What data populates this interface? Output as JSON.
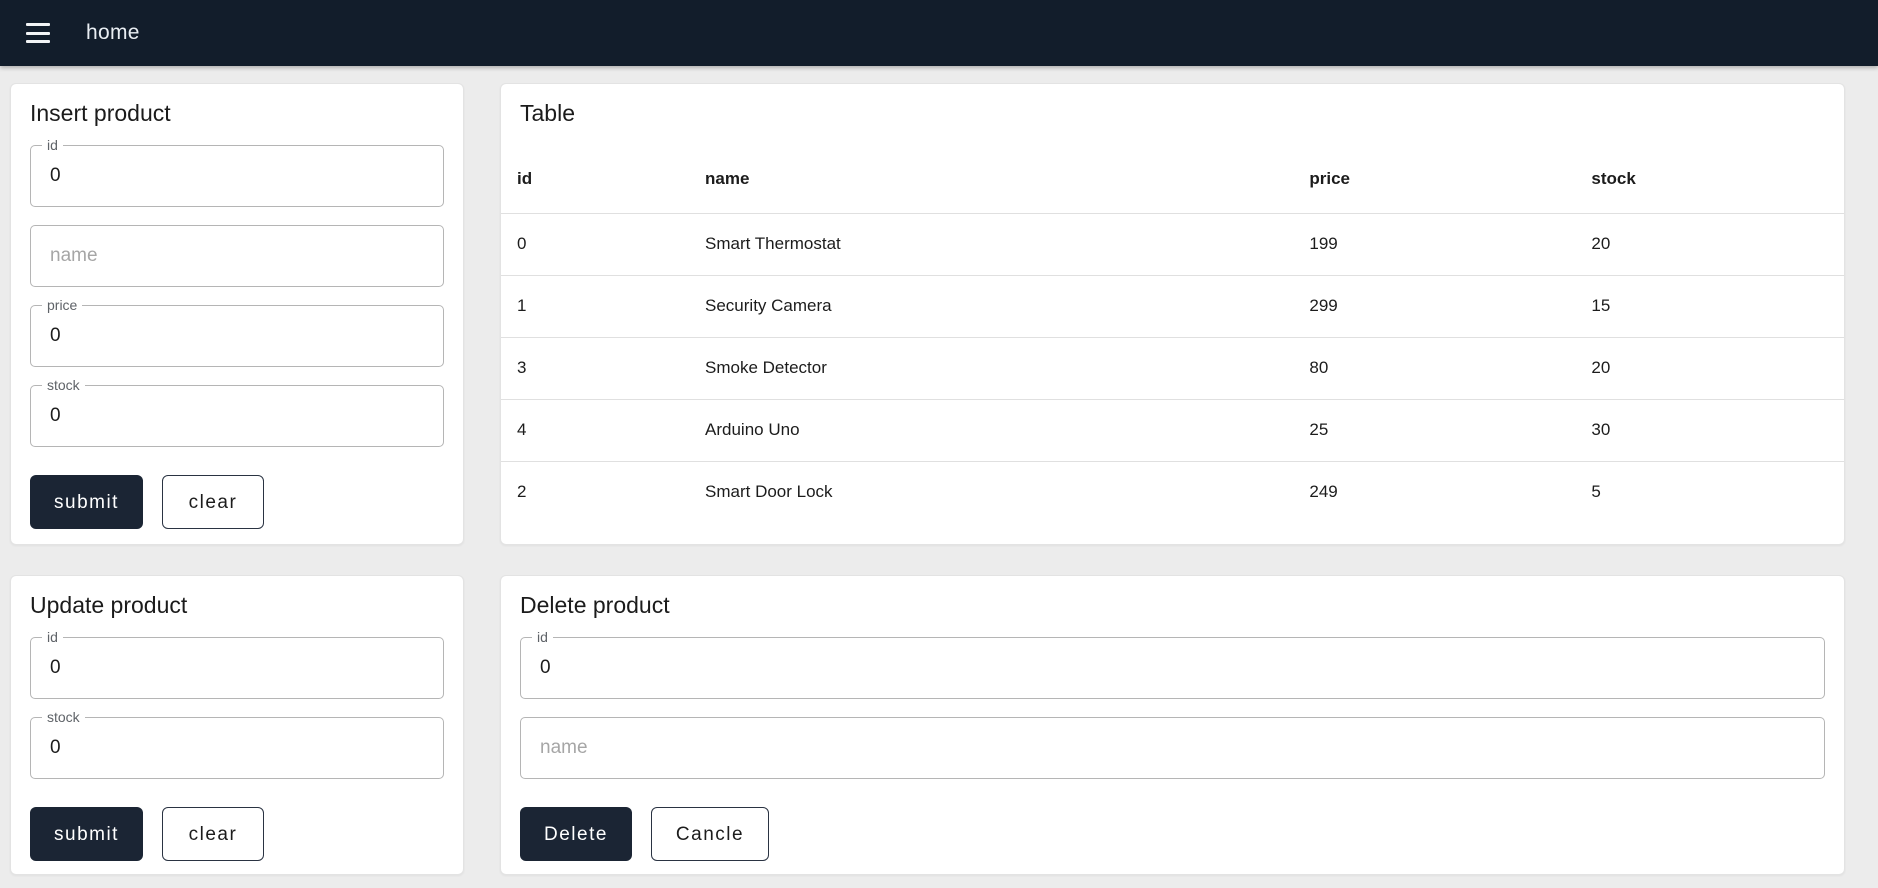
{
  "navbar": {
    "title": "home",
    "menu_icon": "hamburger-menu-icon"
  },
  "insert_card": {
    "title": "Insert product",
    "id_label": "id",
    "id_value": "0",
    "name_placeholder": "name",
    "price_label": "price",
    "price_value": "0",
    "stock_label": "stock",
    "stock_value": "0",
    "submit_label": "submit",
    "clear_label": "clear"
  },
  "table_card": {
    "title": "Table",
    "columns": [
      "id",
      "name",
      "price",
      "stock"
    ],
    "rows": [
      [
        "0",
        "Smart Thermostat",
        "199",
        "20"
      ],
      [
        "1",
        "Security Camera",
        "299",
        "15"
      ],
      [
        "3",
        "Smoke Detector",
        "80",
        "20"
      ],
      [
        "4",
        "Arduino Uno",
        "25",
        "30"
      ],
      [
        "2",
        "Smart Door Lock",
        "249",
        "5"
      ]
    ]
  },
  "update_card": {
    "title": "Update product",
    "id_label": "id",
    "id_value": "0",
    "stock_label": "stock",
    "stock_value": "0",
    "submit_label": "submit",
    "clear_label": "clear"
  },
  "delete_card": {
    "title": "Delete product",
    "id_label": "id",
    "id_value": "0",
    "name_placeholder": "name",
    "delete_label": "Delete",
    "cancel_label": "Cancle"
  },
  "colors": {
    "navbar_bg": "#121d2b",
    "button_bg": "#1b2534",
    "page_bg": "#ececec",
    "card_bg": "#ffffff",
    "divider": "#e0e0e0"
  }
}
